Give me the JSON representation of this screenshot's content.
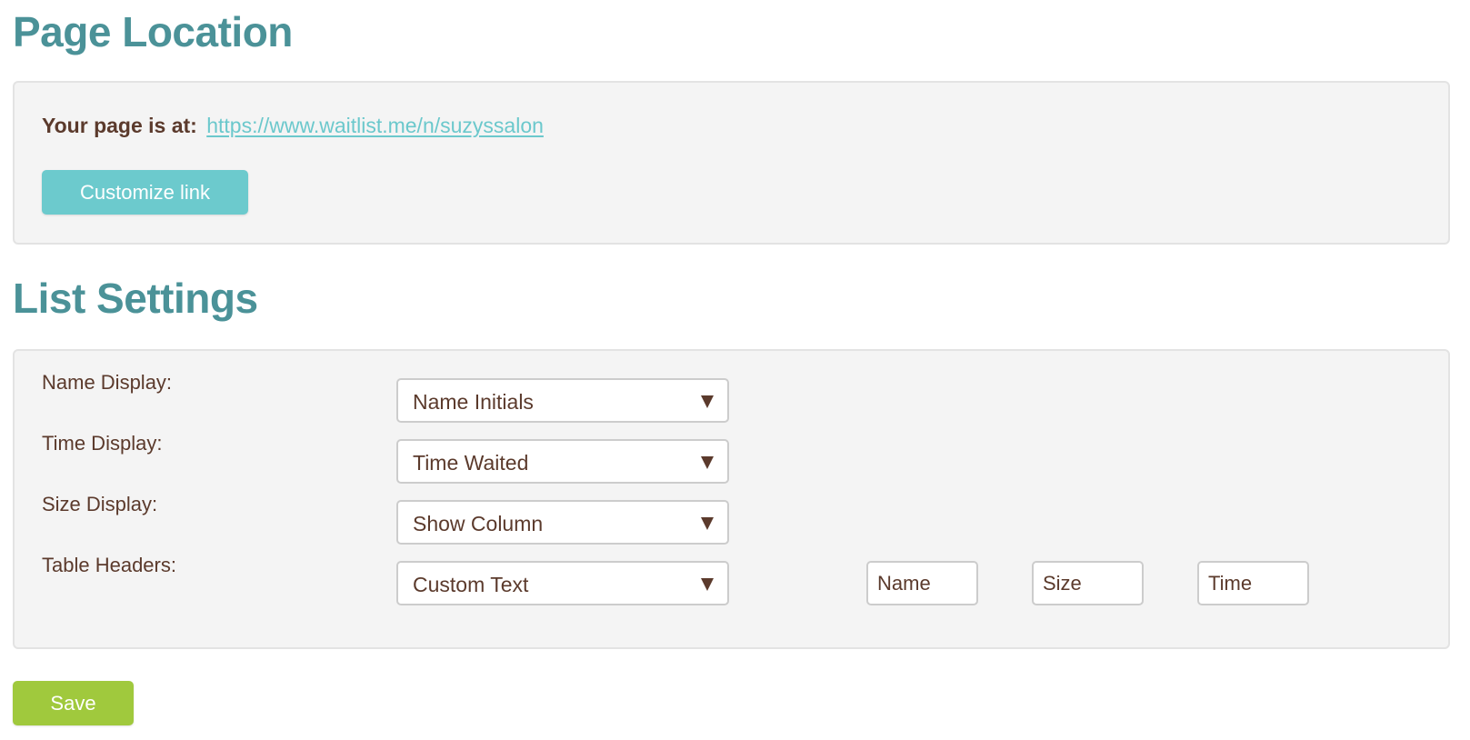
{
  "page_location": {
    "heading": "Page Location",
    "url_label": "Your page is at:",
    "url": "https://www.waitlist.me/n/suzyssalon",
    "customize_button": "Customize link"
  },
  "list_settings": {
    "heading": "List Settings",
    "rows": [
      {
        "label": "Name Display:",
        "selected": "Name Initials"
      },
      {
        "label": "Time Display:",
        "selected": "Time Waited"
      },
      {
        "label": "Size Display:",
        "selected": "Show Column"
      },
      {
        "label": "Table Headers:",
        "selected": "Custom Text"
      }
    ],
    "table_header_inputs": {
      "name": "Name",
      "size": "Size",
      "time": "Time"
    }
  },
  "save_button": "Save",
  "colors": {
    "heading": "#4b9298",
    "link": "#6bc8cc",
    "customize_button": "#6ccacd",
    "save_button": "#a0c93d",
    "text": "#5b3a2c",
    "panel_bg": "#f4f4f4"
  },
  "icons": {
    "select_arrow": "caret-down-icon"
  }
}
